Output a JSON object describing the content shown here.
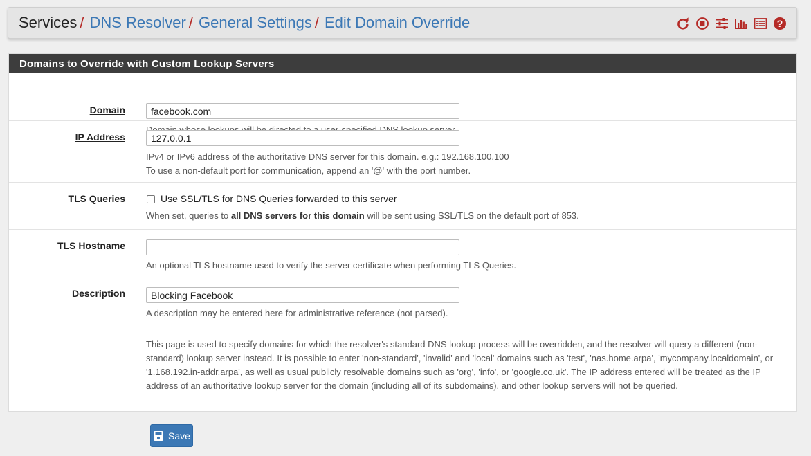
{
  "breadcrumb": {
    "root": "Services",
    "items": [
      "DNS Resolver",
      "General Settings",
      "Edit Domain Override"
    ],
    "separator": "/"
  },
  "header_icons": [
    "reload-icon",
    "stop-icon",
    "sliders-icon",
    "chart-icon",
    "list-icon",
    "help-icon"
  ],
  "colors": {
    "accent": "#3c78b5",
    "danger": "#b52b27",
    "panel_heading": "#3d3d3d"
  },
  "panel": {
    "title": "Domains to Override with Custom Lookup Servers",
    "domain": {
      "label": "Domain",
      "value": "facebook.com",
      "help": "Domain whose lookups will be directed to a user-specified DNS lookup server."
    },
    "ip": {
      "label": "IP Address",
      "value": "127.0.0.1",
      "help1": "IPv4 or IPv6 address of the authoritative DNS server for this domain. e.g.: 192.168.100.100",
      "help2": "To use a non-default port for communication, append an '@' with the port number."
    },
    "tls": {
      "label": "TLS Queries",
      "checkbox_label": "Use SSL/TLS for DNS Queries forwarded to this server",
      "checked": false,
      "help_pre": "When set, queries to ",
      "help_bold": "all DNS servers for this domain",
      "help_post": " will be sent using SSL/TLS on the default port of 853."
    },
    "tls_hostname": {
      "label": "TLS Hostname",
      "value": "",
      "help": "An optional TLS hostname used to verify the server certificate when performing TLS Queries."
    },
    "description": {
      "label": "Description",
      "value": "Blocking Facebook",
      "help": "A description may be entered here for administrative reference (not parsed)."
    },
    "info": "This page is used to specify domains for which the resolver's standard DNS lookup process will be overridden, and the resolver will query a different (non-standard) lookup server instead. It is possible to enter 'non-standard', 'invalid' and 'local' domains such as 'test', 'nas.home.arpa', 'mycompany.localdomain', or '1.168.192.in-addr.arpa', as well as usual publicly resolvable domains such as 'org', 'info', or 'google.co.uk'. The IP address entered will be treated as the IP address of an authoritative lookup server for the domain (including all of its subdomains), and other lookup servers will not be queried."
  },
  "save_label": "Save"
}
